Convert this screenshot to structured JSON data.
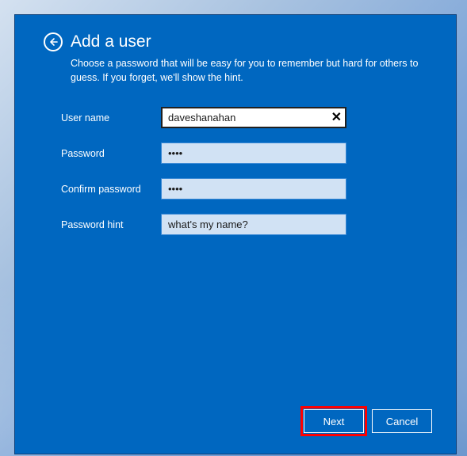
{
  "dialog": {
    "title": "Add a user",
    "subtitle": "Choose a password that will be easy for you to remember but hard for others to guess. If you forget, we'll show the hint."
  },
  "form": {
    "username": {
      "label": "User name",
      "value": "daveshanahan"
    },
    "password": {
      "label": "Password",
      "value": "••••"
    },
    "confirm": {
      "label": "Confirm password",
      "value": "••••"
    },
    "hint": {
      "label": "Password hint",
      "value": "what's my name?"
    }
  },
  "buttons": {
    "next": "Next",
    "cancel": "Cancel"
  },
  "icons": {
    "clear": "✕"
  }
}
